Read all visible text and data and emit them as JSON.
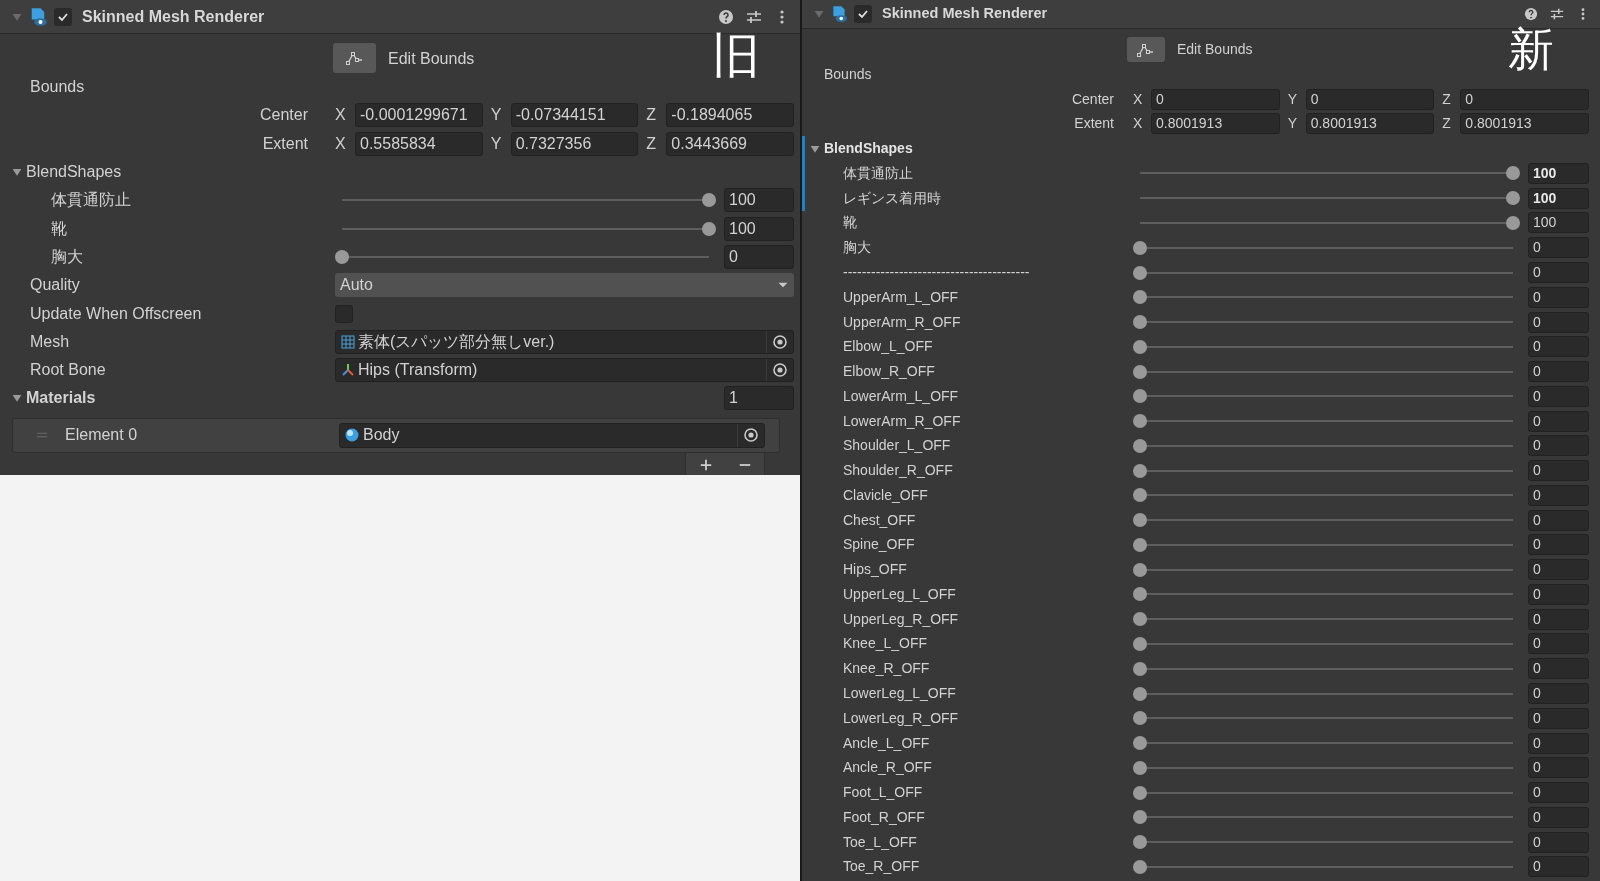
{
  "panels": [
    {
      "component": {
        "title": "Skinned Mesh Renderer",
        "enabled": true
      },
      "badge": "旧",
      "edit_bounds": "Edit Bounds",
      "bounds": {
        "label": "Bounds",
        "rows": [
          {
            "label": "Center",
            "fields": [
              {
                "axis": "X",
                "value": "-0.0001299671"
              },
              {
                "axis": "Y",
                "value": "-0.07344151"
              },
              {
                "axis": "Z",
                "value": "-0.1894065"
              }
            ]
          },
          {
            "label": "Extent",
            "fields": [
              {
                "axis": "X",
                "value": "0.5585834"
              },
              {
                "axis": "Y",
                "value": "0.7327356"
              },
              {
                "axis": "Z",
                "value": "0.3443669"
              }
            ]
          }
        ]
      },
      "blend_shapes": {
        "label": "BlendShapes",
        "expanded": true,
        "overridden": false,
        "items": [
          {
            "name": "体貫通防止",
            "level": 1,
            "value": "100",
            "overridden": false
          },
          {
            "name": "靴",
            "level": 1,
            "value": "100",
            "overridden": false
          },
          {
            "name": "胸大",
            "level": 0,
            "value": "0",
            "overridden": false
          }
        ]
      },
      "properties": [
        {
          "kind": "dropdown",
          "label": "Quality",
          "value": "Auto"
        },
        {
          "kind": "checkbox",
          "label": "Update When Offscreen",
          "checked": false
        },
        {
          "kind": "mesh",
          "label": "Mesh",
          "value": "素体(スパッツ部分無しver.)"
        },
        {
          "kind": "transform",
          "label": "Root Bone",
          "value": "Hips (Transform)"
        }
      ],
      "materials": {
        "label": "Materials",
        "expanded": true,
        "count": "1",
        "elements": [
          {
            "kind": "material",
            "label": "Element 0",
            "value": "Body"
          }
        ]
      }
    },
    {
      "component": {
        "title": "Skinned Mesh Renderer",
        "enabled": true
      },
      "badge": "新",
      "edit_bounds": "Edit Bounds",
      "bounds": {
        "label": "Bounds",
        "rows": [
          {
            "label": "Center",
            "fields": [
              {
                "axis": "X",
                "value": "0"
              },
              {
                "axis": "Y",
                "value": "0"
              },
              {
                "axis": "Z",
                "value": "0"
              }
            ]
          },
          {
            "label": "Extent",
            "fields": [
              {
                "axis": "X",
                "value": "0.8001913"
              },
              {
                "axis": "Y",
                "value": "0.8001913"
              },
              {
                "axis": "Z",
                "value": "0.8001913"
              }
            ]
          }
        ]
      },
      "blend_shapes": {
        "label": "BlendShapes",
        "expanded": true,
        "overridden": true,
        "items": [
          {
            "name": "体貫通防止",
            "level": 1,
            "value": "100",
            "overridden": true
          },
          {
            "name": "レギンス着用時",
            "level": 1,
            "value": "100",
            "overridden": true
          },
          {
            "name": "靴",
            "level": 1,
            "value": "100",
            "overridden": false
          },
          {
            "name": "胸大",
            "level": 0,
            "value": "0",
            "overridden": false
          },
          {
            "name": "----------------------------------------",
            "level": 0,
            "value": "0",
            "overridden": false
          },
          {
            "name": "UpperArm_L_OFF",
            "level": 0,
            "value": "0",
            "overridden": false
          },
          {
            "name": "UpperArm_R_OFF",
            "level": 0,
            "value": "0",
            "overridden": false
          },
          {
            "name": "Elbow_L_OFF",
            "level": 0,
            "value": "0",
            "overridden": false
          },
          {
            "name": "Elbow_R_OFF",
            "level": 0,
            "value": "0",
            "overridden": false
          },
          {
            "name": "LowerArm_L_OFF",
            "level": 0,
            "value": "0",
            "overridden": false
          },
          {
            "name": "LowerArm_R_OFF",
            "level": 0,
            "value": "0",
            "overridden": false
          },
          {
            "name": "Shoulder_L_OFF",
            "level": 0,
            "value": "0",
            "overridden": false
          },
          {
            "name": "Shoulder_R_OFF",
            "level": 0,
            "value": "0",
            "overridden": false
          },
          {
            "name": "Clavicle_OFF",
            "level": 0,
            "value": "0",
            "overridden": false
          },
          {
            "name": "Chest_OFF",
            "level": 0,
            "value": "0",
            "overridden": false
          },
          {
            "name": "Spine_OFF",
            "level": 0,
            "value": "0",
            "overridden": false
          },
          {
            "name": "Hips_OFF",
            "level": 0,
            "value": "0",
            "overridden": false
          },
          {
            "name": "UpperLeg_L_OFF",
            "level": 0,
            "value": "0",
            "overridden": false
          },
          {
            "name": "UpperLeg_R_OFF",
            "level": 0,
            "value": "0",
            "overridden": false
          },
          {
            "name": "Knee_L_OFF",
            "level": 0,
            "value": "0",
            "overridden": false
          },
          {
            "name": "Knee_R_OFF",
            "level": 0,
            "value": "0",
            "overridden": false
          },
          {
            "name": "LowerLeg_L_OFF",
            "level": 0,
            "value": "0",
            "overridden": false
          },
          {
            "name": "LowerLeg_R_OFF",
            "level": 0,
            "value": "0",
            "overridden": false
          },
          {
            "name": "Ancle_L_OFF",
            "level": 0,
            "value": "0",
            "overridden": false
          },
          {
            "name": "Ancle_R_OFF",
            "level": 0,
            "value": "0",
            "overridden": false
          },
          {
            "name": "Foot_L_OFF",
            "level": 0,
            "value": "0",
            "overridden": false
          },
          {
            "name": "Foot_R_OFF",
            "level": 0,
            "value": "0",
            "overridden": false
          },
          {
            "name": "Toe_L_OFF",
            "level": 0,
            "value": "0",
            "overridden": false
          },
          {
            "name": "Toe_R_OFF",
            "level": 0,
            "value": "0",
            "overridden": false
          }
        ]
      }
    }
  ]
}
